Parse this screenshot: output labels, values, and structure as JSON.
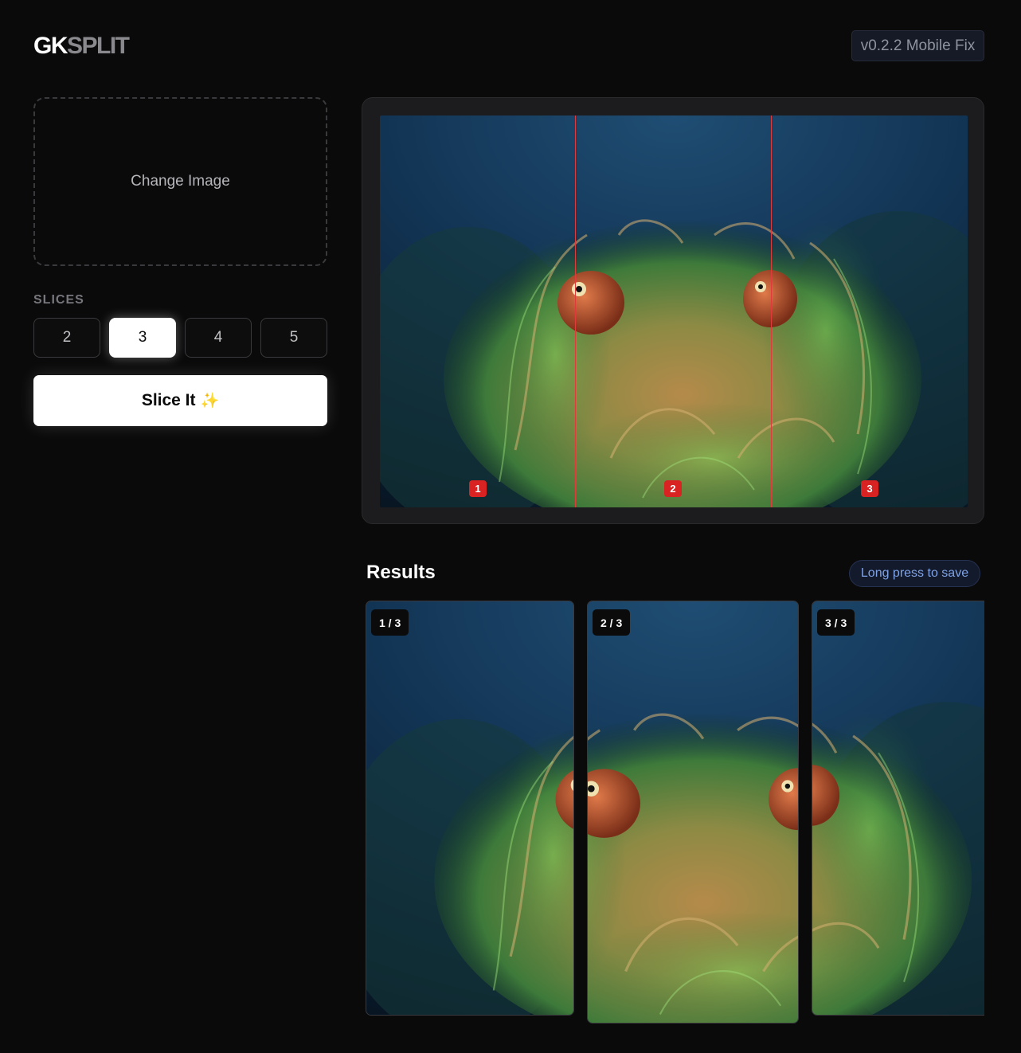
{
  "header": {
    "logo_part1": "GK",
    "logo_part2": "SPLIT",
    "version": "v0.2.2 Mobile Fix"
  },
  "upload": {
    "label": "Change Image"
  },
  "slices": {
    "label": "SLICES",
    "options": [
      "2",
      "3",
      "4",
      "5"
    ],
    "selected": "3"
  },
  "actions": {
    "slice_label": "Slice It",
    "slice_icon": "sparkles-icon"
  },
  "preview": {
    "markers": [
      "1",
      "2",
      "3"
    ],
    "cut_line_color": "#e23a3a",
    "marker_color": "#d92323"
  },
  "results": {
    "title": "Results",
    "hint": "Long press to save",
    "items": [
      {
        "label": "1 / 3"
      },
      {
        "label": "2 / 3"
      },
      {
        "label": "3 / 3"
      }
    ]
  },
  "colors": {
    "background": "#0a0a0a",
    "accent": "#ffffff",
    "hint_text": "#7fa3e6"
  }
}
